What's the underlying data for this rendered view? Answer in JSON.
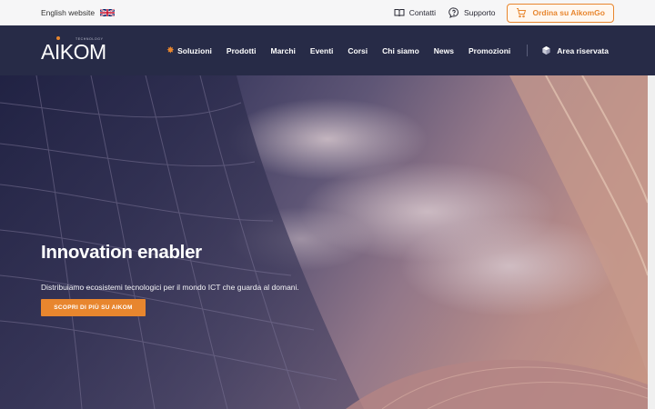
{
  "topbar": {
    "language_label": "English website",
    "flag_icon": "uk-flag-icon",
    "contacts_label": "Contatti",
    "support_label": "Supporto",
    "order_label": "Ordina su AikomGo"
  },
  "brand": {
    "name": "AIKOM",
    "tagline": "TECHNOLOGY",
    "accent_color": "#e8862e",
    "nav_color": "#272b47"
  },
  "nav": {
    "items": [
      {
        "label": "Soluzioni",
        "icon": "sun-icon"
      },
      {
        "label": "Prodotti"
      },
      {
        "label": "Marchi"
      },
      {
        "label": "Eventi"
      },
      {
        "label": "Corsi"
      },
      {
        "label": "Chi siamo"
      },
      {
        "label": "News"
      },
      {
        "label": "Promozioni"
      }
    ],
    "reserved_area_label": "Area riservata",
    "reserved_area_icon": "box-icon"
  },
  "hero": {
    "title": "Innovation enabler",
    "subtitle": "Distribuiamo ecosistemi tecnologici per il mondo ICT che guarda al domani.",
    "cta_label": "SCOPRI DI PIÙ SU AIKOM"
  }
}
